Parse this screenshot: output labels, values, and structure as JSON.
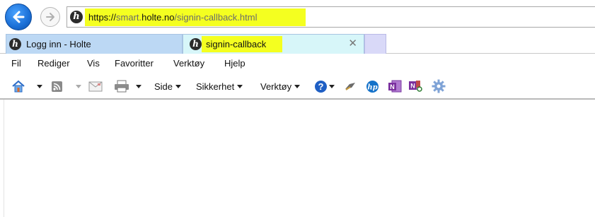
{
  "address": {
    "url_prefix": "https://",
    "url_host_light": "smart.",
    "url_host_strong": "holte.no",
    "url_path": "/signin-callback.html",
    "site_icon_glyph": "h"
  },
  "tabs": [
    {
      "label": "Logg inn - Holte",
      "icon_glyph": "h",
      "active": false
    },
    {
      "label": "signin-callback",
      "icon_glyph": "h",
      "active": true,
      "close_glyph": "✕"
    }
  ],
  "menu": [
    "Fil",
    "Rediger",
    "Vis",
    "Favoritter",
    "Verktøy",
    "Hjelp"
  ],
  "commands": {
    "side": "Side",
    "sikkerhet": "Sikkerhet",
    "verktoy": "Verktøy"
  },
  "icons": {
    "back": "back-arrow-icon",
    "forward": "forward-arrow-icon",
    "home": "home-icon",
    "feeds": "feeds-icon",
    "mail": "mail-icon",
    "print": "print-icon",
    "help": "help-icon",
    "research": "research-icon",
    "hp": "hp-icon",
    "onenote1": "onenote-icon",
    "onenote2": "onenote-linked-icon",
    "settings": "gear-icon"
  },
  "colors": {
    "highlight": "#f4ff20",
    "tab_inactive": "#bcd8f4",
    "tab_active": "#d7f6f9",
    "back_button": "#1a6fd6"
  }
}
